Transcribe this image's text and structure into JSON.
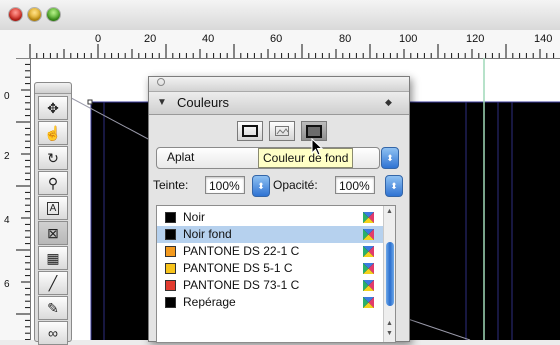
{
  "window": {
    "controls": [
      "close",
      "minimize",
      "zoom"
    ]
  },
  "ruler": {
    "horizontal_labels": [
      "0",
      "20",
      "40",
      "60",
      "80",
      "100",
      "120",
      "140"
    ],
    "vertical_labels": [
      "0",
      "2",
      "4",
      "6"
    ]
  },
  "toolbox": {
    "tools": [
      "selection-tool",
      "hand-tool",
      "rotate-tool",
      "zoom-tool",
      "text-frame-tool",
      "picture-frame-tool",
      "table-tool",
      "line-tool",
      "bezier-tool",
      "linking-tool"
    ]
  },
  "panel": {
    "title": "Couleurs",
    "mode_buttons": [
      "frame-color",
      "picture-color",
      "background-color"
    ],
    "fill_type": "Aplat",
    "tint_label": "Teinte:",
    "tint_value": "100%",
    "opacity_label": "Opacité:",
    "opacity_value": "100%",
    "colors": [
      {
        "name": "Noir",
        "swatch": "#000000",
        "selected": false
      },
      {
        "name": "Noir fond",
        "swatch": "#000000",
        "selected": true
      },
      {
        "name": "PANTONE DS 22-1 C",
        "swatch": "#f39a1e",
        "selected": false
      },
      {
        "name": "PANTONE DS 5-1 C",
        "swatch": "#f7c31b",
        "selected": false
      },
      {
        "name": "PANTONE DS 73-1 C",
        "swatch": "#e23b2f",
        "selected": false
      },
      {
        "name": "Repérage",
        "swatch": "#000000",
        "selected": false
      }
    ]
  },
  "tooltip": {
    "text": "Couleur de fond"
  },
  "colors": {
    "selection": "#b6d1ee",
    "accent": "#2f73d3",
    "tooltip_bg": "#ffffc6",
    "guide": "#3a3a9a",
    "guide_green": "#9fd9b8"
  }
}
